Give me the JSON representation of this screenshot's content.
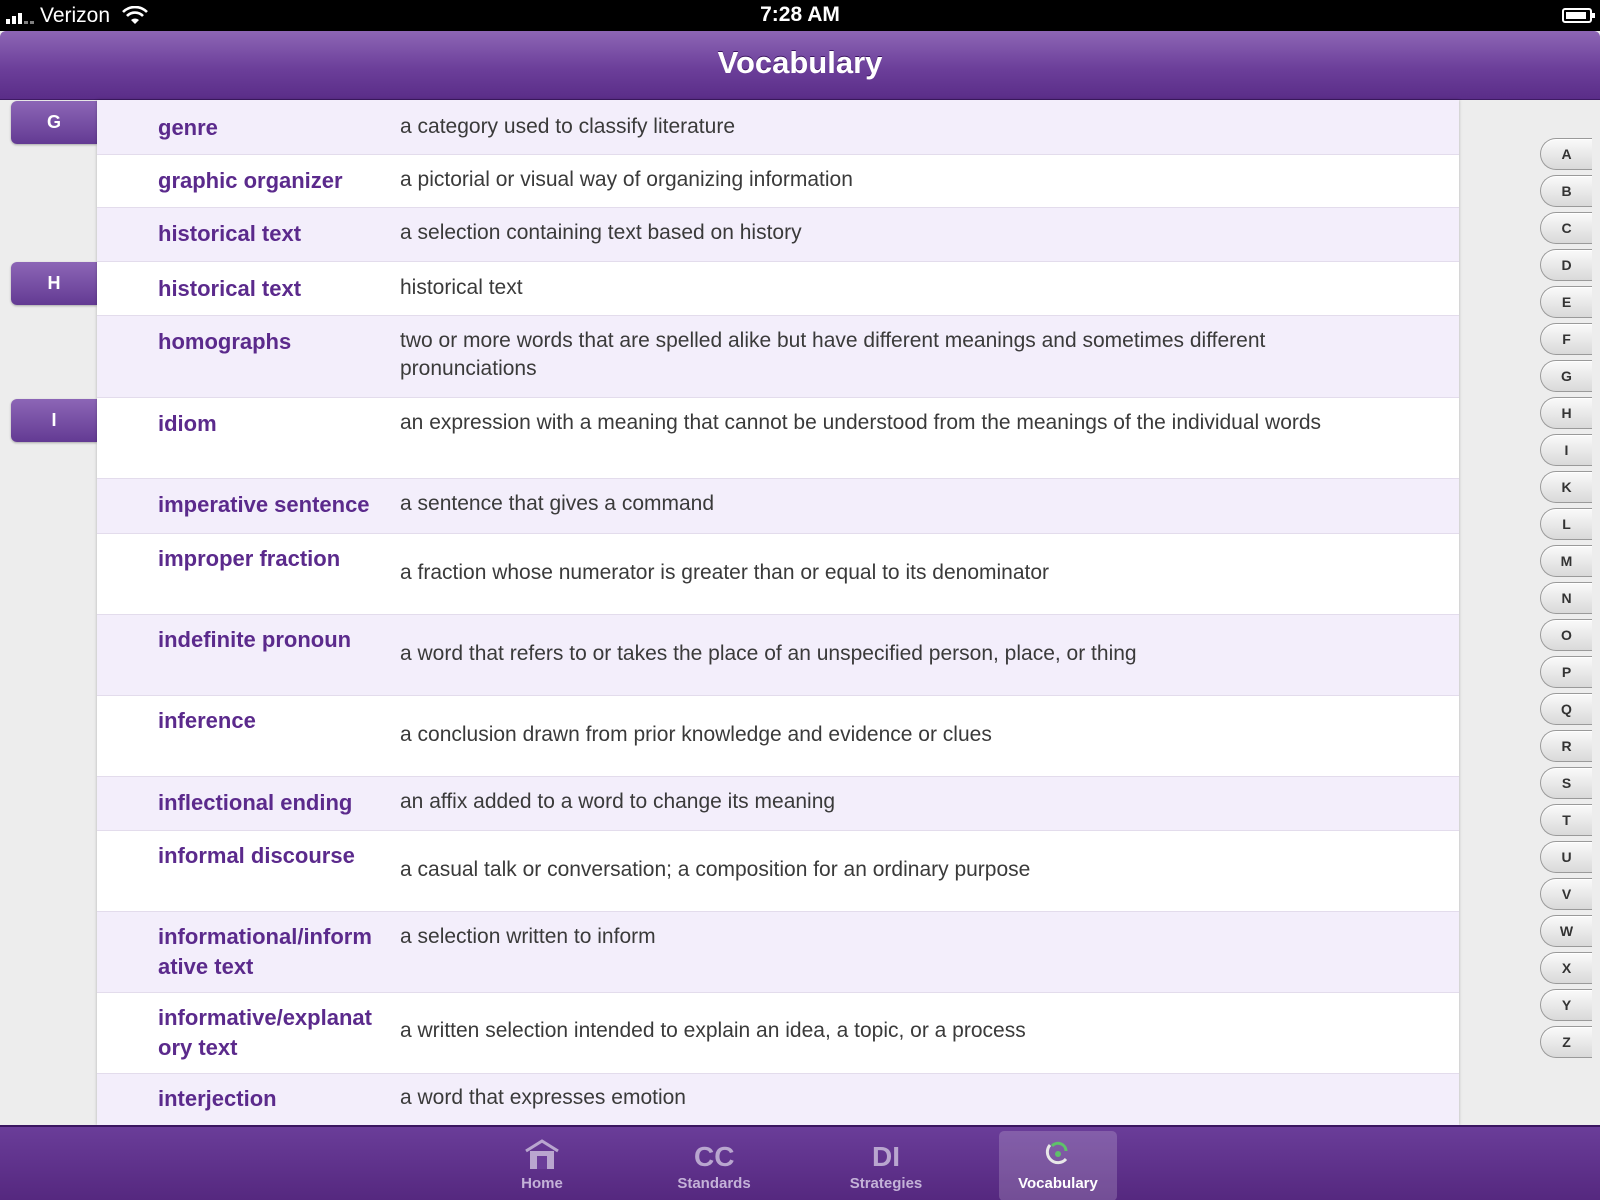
{
  "status_bar": {
    "carrier": "Verizon",
    "time": "7:28 AM"
  },
  "nav": {
    "title": "Vocabulary"
  },
  "section_tabs": [
    "G",
    "H",
    "I"
  ],
  "entries": [
    {
      "term": "genre",
      "definition": "a category used to classify literature"
    },
    {
      "term": "graphic organizer",
      "definition": "a pictorial or visual way of organizing information"
    },
    {
      "term": "historical text",
      "definition": "a selection containing text based on history"
    },
    {
      "term": "historical text",
      "definition": "historical text"
    },
    {
      "term": "homographs",
      "definition": "two or more words that are spelled alike but have different meanings and sometimes different pronunciations"
    },
    {
      "term": "idiom",
      "definition": "an expression with a meaning that cannot be understood from the meanings of the individual words"
    },
    {
      "term": "imperative sentence",
      "definition": "a sentence that gives a command"
    },
    {
      "term": "improper fraction",
      "definition": "a fraction whose numerator is greater than or equal to its denominator"
    },
    {
      "term": "indefinite pronoun",
      "definition": "a word that refers to or takes the place of an unspecified person, place, or thing"
    },
    {
      "term": "inference",
      "definition": "a conclusion drawn from prior knowledge and evidence or clues"
    },
    {
      "term": "inflectional ending",
      "definition": "an affix added to a word to change its meaning"
    },
    {
      "term": "informal discourse",
      "definition": "a casual talk or conversation; a composition for an ordinary purpose"
    },
    {
      "term": "informational/inform ative text",
      "definition": "a selection written to inform"
    },
    {
      "term": "informative/explanat ory text",
      "definition": "a written selection intended to explain an idea, a topic, or a process"
    },
    {
      "term": "interjection",
      "definition": "a word that expresses emotion"
    }
  ],
  "alphabet": [
    "A",
    "B",
    "C",
    "D",
    "E",
    "F",
    "G",
    "H",
    "I",
    "K",
    "L",
    "M",
    "N",
    "O",
    "P",
    "Q",
    "R",
    "S",
    "T",
    "U",
    "V",
    "W",
    "X",
    "Y",
    "Z"
  ],
  "tab_bar": {
    "items": [
      {
        "label": "Home",
        "icon": "home-icon"
      },
      {
        "label": "Standards",
        "icon": "standards-icon",
        "icon_text": "CC"
      },
      {
        "label": "Strategies",
        "icon": "strategies-icon",
        "icon_text": "DI"
      },
      {
        "label": "Vocabulary",
        "icon": "vocabulary-icon"
      }
    ],
    "active": "Vocabulary"
  },
  "colors": {
    "brand_purple": "#6c3f9a",
    "term_color": "#5b2a8c",
    "row_alt": "#f3eefb"
  }
}
